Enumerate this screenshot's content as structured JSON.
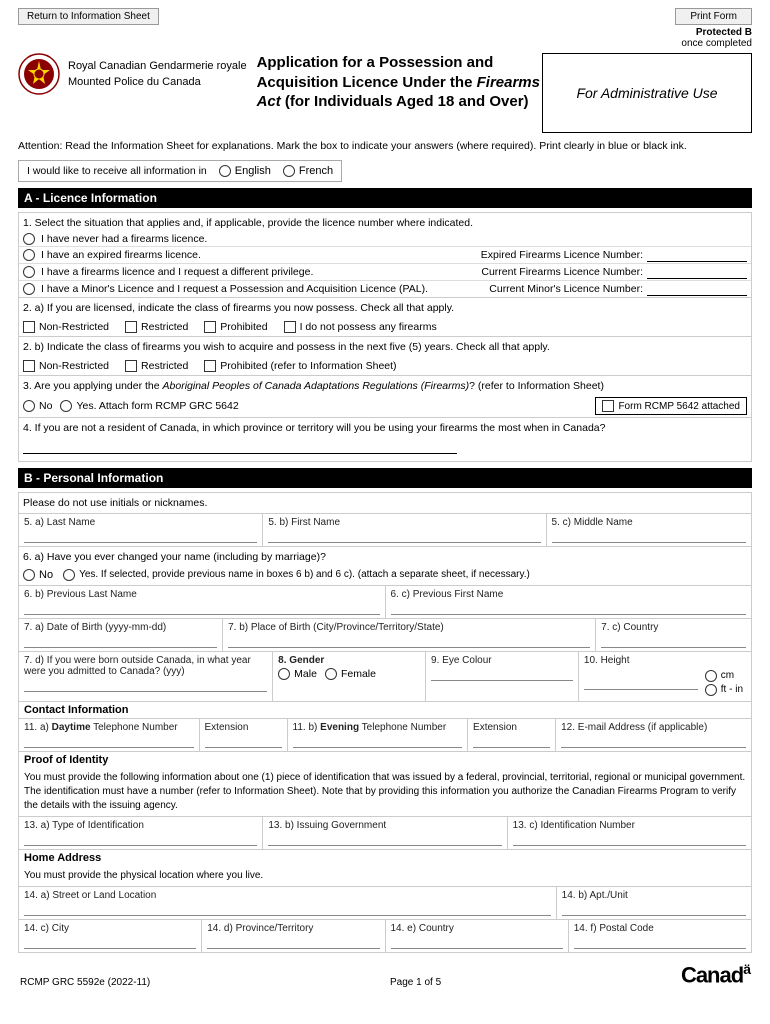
{
  "header": {
    "return_btn": "Return to Information Sheet",
    "print_btn": "Print Form",
    "protected": "Protected B",
    "once_completed": "once completed",
    "org_line1": "Royal Canadian",
    "org_line2": "Mounted Police",
    "org_fr1": "Gendarmerie royale",
    "org_fr2": "du Canada",
    "main_title": "Application for a Possession and Acquisition Licence Under the Firearms Act (for Individuals Aged 18 and Over)",
    "admin_box": "For Administrative Use"
  },
  "attention": {
    "text": "Attention: Read the Information Sheet for explanations. Mark the box to indicate your answers (where required). Print clearly in blue or black ink."
  },
  "language_pref": {
    "label": "I would like to receive all information in",
    "english": "English",
    "french": "French"
  },
  "section_a": {
    "header": "A - Licence Information",
    "q1_text": "1. Select the situation that applies and, if applicable, provide the licence number where indicated.",
    "options": [
      "I have never had a firearms licence.",
      "I have an expired firearms licence.",
      "I have a firearms licence and I request a different privilege.",
      "I have a Minor's Licence and I request a Possession and Acquisition Licence (PAL)."
    ],
    "expired_label": "Expired Firearms Licence Number:",
    "current_label": "Current Firearms Licence Number:",
    "minors_label": "Current Minor's Licence Number:",
    "q2a_text": "2. a) If you are licensed, indicate the class of firearms you now possess. Check all that apply.",
    "q2a_options": [
      "Non-Restricted",
      "Restricted",
      "Prohibited",
      "I do not possess any firearms"
    ],
    "q2b_text": "2. b) Indicate the class of firearms you wish to acquire and possess in the next five (5) years. Check all that apply.",
    "q2b_options": [
      "Non-Restricted",
      "Restricted",
      "Prohibited (refer to Information Sheet)"
    ],
    "q3_text": "3. Are you applying under the Aboriginal Peoples of Canada Adaptations Regulations (Firearms)? (refer to Information Sheet)",
    "q3_no": "No",
    "q3_yes": "Yes. Attach form RCMP GRC 5642",
    "q3_attached": "Form RCMP 5642 attached",
    "q4_text": "4. If you are not a resident of Canada, in which province or territory will you be using your firearms the most when in Canada?"
  },
  "section_b": {
    "header": "B - Personal Information",
    "please_note": "Please do not use initials or nicknames.",
    "q5a": "5. a) Last Name",
    "q5b": "5. b) First Name",
    "q5c": "5. c) Middle Name",
    "q6a": "6. a) Have you ever changed your name (including by marriage)?",
    "q6_no": "No",
    "q6_yes": "Yes. If selected, provide previous name in boxes 6 b) and 6 c). (attach a separate sheet, if necessary.)",
    "q6b": "6. b) Previous Last Name",
    "q6c": "6. c) Previous First Name",
    "q7a": "7. a) Date of Birth (yyyy-mm-dd)",
    "q7b": "7. b) Place of Birth (City/Province/Territory/State)",
    "q7c": "7. c) Country",
    "q7d": "7. d) If you were born outside Canada, in what year were you admitted to Canada? (yyy)",
    "q8": "8. Gender",
    "q8_male": "Male",
    "q8_female": "Female",
    "q9": "9. Eye Colour",
    "q10": "10. Height",
    "q10_cm": "cm",
    "q10_ft": "ft - in",
    "contact_header": "Contact Information",
    "q11a": "11. a) Daytime Telephone Number",
    "q11a_ext": "Extension",
    "q11b": "11. b) Evening Telephone Number",
    "q11b_ext": "Extension",
    "q12": "12. E-mail Address (if applicable)",
    "proof_header": "Proof of Identity",
    "proof_text": "You must provide the following information about one (1) piece of identification that was issued by a federal, provincial, territorial, regional or municipal government. The identification must have a number (refer to Information Sheet). Note that by providing this information you authorize the Canadian Firearms Program to verify the details with the issuing agency.",
    "q13a": "13. a) Type of Identification",
    "q13b": "13. b) Issuing Government",
    "q13c": "13. c) Identification Number",
    "home_header": "Home Address",
    "home_text": "You must provide the physical location where you live.",
    "q14a": "14. a) Street or Land Location",
    "q14b": "14. b) Apt./Unit",
    "q14c": "14. c) City",
    "q14d": "14. d) Province/Territory",
    "q14e": "14. e) Country",
    "q14f": "14. f) Postal Code"
  },
  "footer": {
    "form_number": "RCMP GRC 5592e (2022-11)",
    "page": "Page 1 of 5",
    "canada": "Canadä"
  }
}
